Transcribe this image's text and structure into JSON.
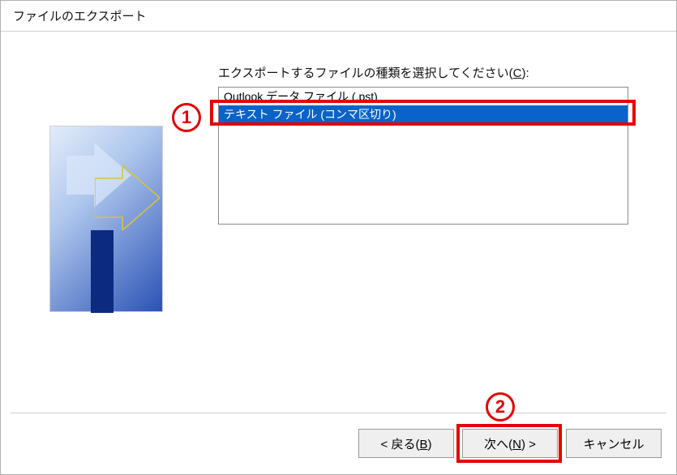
{
  "window": {
    "title": "ファイルのエクスポート"
  },
  "prompt": {
    "text_pre": "エクスポートするファイルの種類を選択してください(",
    "hotkey": "C",
    "text_post": "):"
  },
  "listbox": {
    "items": [
      "Outlook データ ファイル (.pst)",
      "テキスト ファイル (コンマ区切り)"
    ],
    "selected_index": 1
  },
  "annotations": {
    "marker1": "1",
    "marker2": "2"
  },
  "buttons": {
    "back": {
      "lt": "< 戻る(",
      "hot": "B",
      "rt": ")"
    },
    "next": {
      "lt": "次へ(",
      "hot": "N",
      "rt": ") >"
    },
    "cancel": {
      "text": "キャンセル"
    }
  }
}
